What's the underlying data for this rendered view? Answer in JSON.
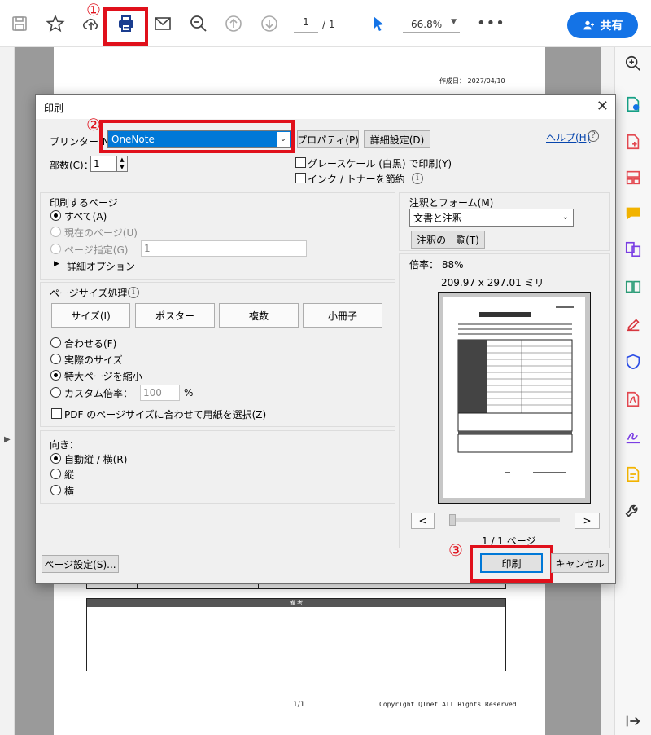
{
  "toolbar": {
    "page_current": "1",
    "page_total": "/ 1",
    "zoom": "66.8%",
    "more": "•••",
    "share_label": "共有",
    "markers": [
      "①",
      "②",
      "③"
    ]
  },
  "document": {
    "date": "作成日： 2027/04/10",
    "remarks_header": "備 考",
    "page_number": "1/1",
    "copyright": "Copyright QTnet All Rights Reserved"
  },
  "dialog": {
    "title": "印刷",
    "printer_label": "プリンター(N)",
    "printer_value": "OneNote",
    "properties_button": "プロパティ(P)",
    "advanced_button": "詳細設定(D)",
    "help_link": "ヘルプ(H)",
    "copies_label": "部数(C)：",
    "copies_value": "1",
    "grayscale_label": "グレースケール (白黒) で印刷(Y)",
    "save_ink_label": "インク / トナーを節約",
    "pages_group_title": "印刷するページ",
    "pages_all": "すべて(A)",
    "pages_current": "現在のページ(U)",
    "pages_specify": "ページ指定(G)",
    "pages_specify_value": "1",
    "more_options": "詳細オプション",
    "size_group_title": "ページサイズ処理",
    "size_tabs": [
      "サイズ(I)",
      "ポスター",
      "複数",
      "小冊子"
    ],
    "fit_option": "合わせる(F)",
    "actual_size_option": "実際のサイズ",
    "shrink_option": "特大ページを縮小",
    "custom_scale_option": "カスタム倍率：",
    "custom_scale_value": "100",
    "percent": "%",
    "pdf_page_size_label": "PDF のページサイズに合わせて用紙を選択(Z)",
    "orientation_title": "向き：",
    "orientation_auto": "自動縦 / 横(R)",
    "orientation_portrait": "縦",
    "orientation_landscape": "横",
    "comments_title": "注釈とフォーム(M)",
    "comments_value": "文書と注釈",
    "comments_list_button": "注釈の一覧(T)",
    "scale_label": "倍率： 88%",
    "paper_size": "209.97 x 297.01 ミリ",
    "nav_prev": "<",
    "nav_next": ">",
    "page_indicator": "1 / 1 ページ",
    "page_setup_button": "ページ設定(S)...",
    "print_button": "印刷",
    "cancel_button": "キャンセル"
  },
  "colors": {
    "accent": "#1473e6",
    "highlight_red": "#e0101b",
    "selection_blue": "#0078d7"
  }
}
